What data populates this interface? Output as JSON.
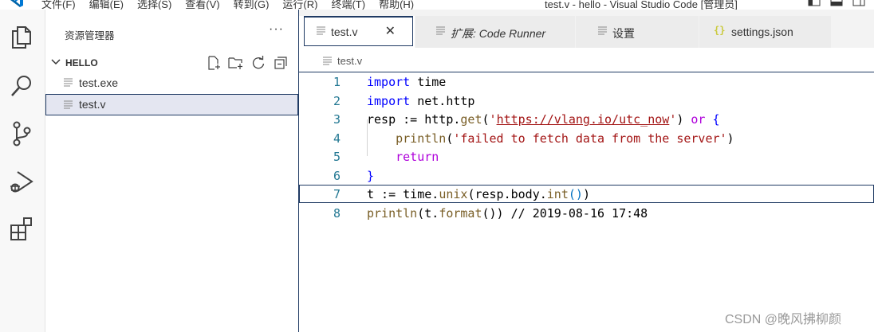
{
  "titlebar": {
    "menu": [
      "文件(F)",
      "编辑(E)",
      "选择(S)",
      "查看(V)",
      "转到(G)",
      "运行(R)",
      "终端(T)",
      "帮助(H)"
    ],
    "window_title": "test.v - hello - Visual Studio Code [管理员]"
  },
  "activity_bar": {
    "items": [
      "explorer-icon",
      "search-icon",
      "source-control-icon",
      "run-debug-icon",
      "extensions-icon"
    ]
  },
  "sidebar": {
    "title": "资源管理器",
    "more": "···",
    "folder": "HELLO",
    "files": [
      {
        "name": "test.exe",
        "selected": false
      },
      {
        "name": "test.v",
        "selected": true
      }
    ]
  },
  "tabs": [
    {
      "label": "test.v",
      "active": true,
      "icon": "file-lines-icon",
      "close": "✕"
    },
    {
      "label": "扩展: Code Runner",
      "active": false,
      "icon": "file-lines-icon"
    },
    {
      "label": "设置",
      "active": false,
      "icon": "file-lines-icon"
    },
    {
      "label": "settings.json",
      "active": false,
      "icon": "json-braces-icon",
      "icon_text": "{}"
    }
  ],
  "breadcrumb": {
    "label": "test.v"
  },
  "editor": {
    "line_numbers": [
      "1",
      "2",
      "3",
      "4",
      "5",
      "6",
      "7",
      "8"
    ],
    "current_line": 7
  },
  "watermark": "CSDN @晚风拂柳颜",
  "colors": {
    "keyword": "#0000ff",
    "control": "#af00db",
    "function": "#795e26",
    "string": "#a31515",
    "comment": "#008000",
    "focus_border": "#1f3a63",
    "line_number": "#237893"
  }
}
